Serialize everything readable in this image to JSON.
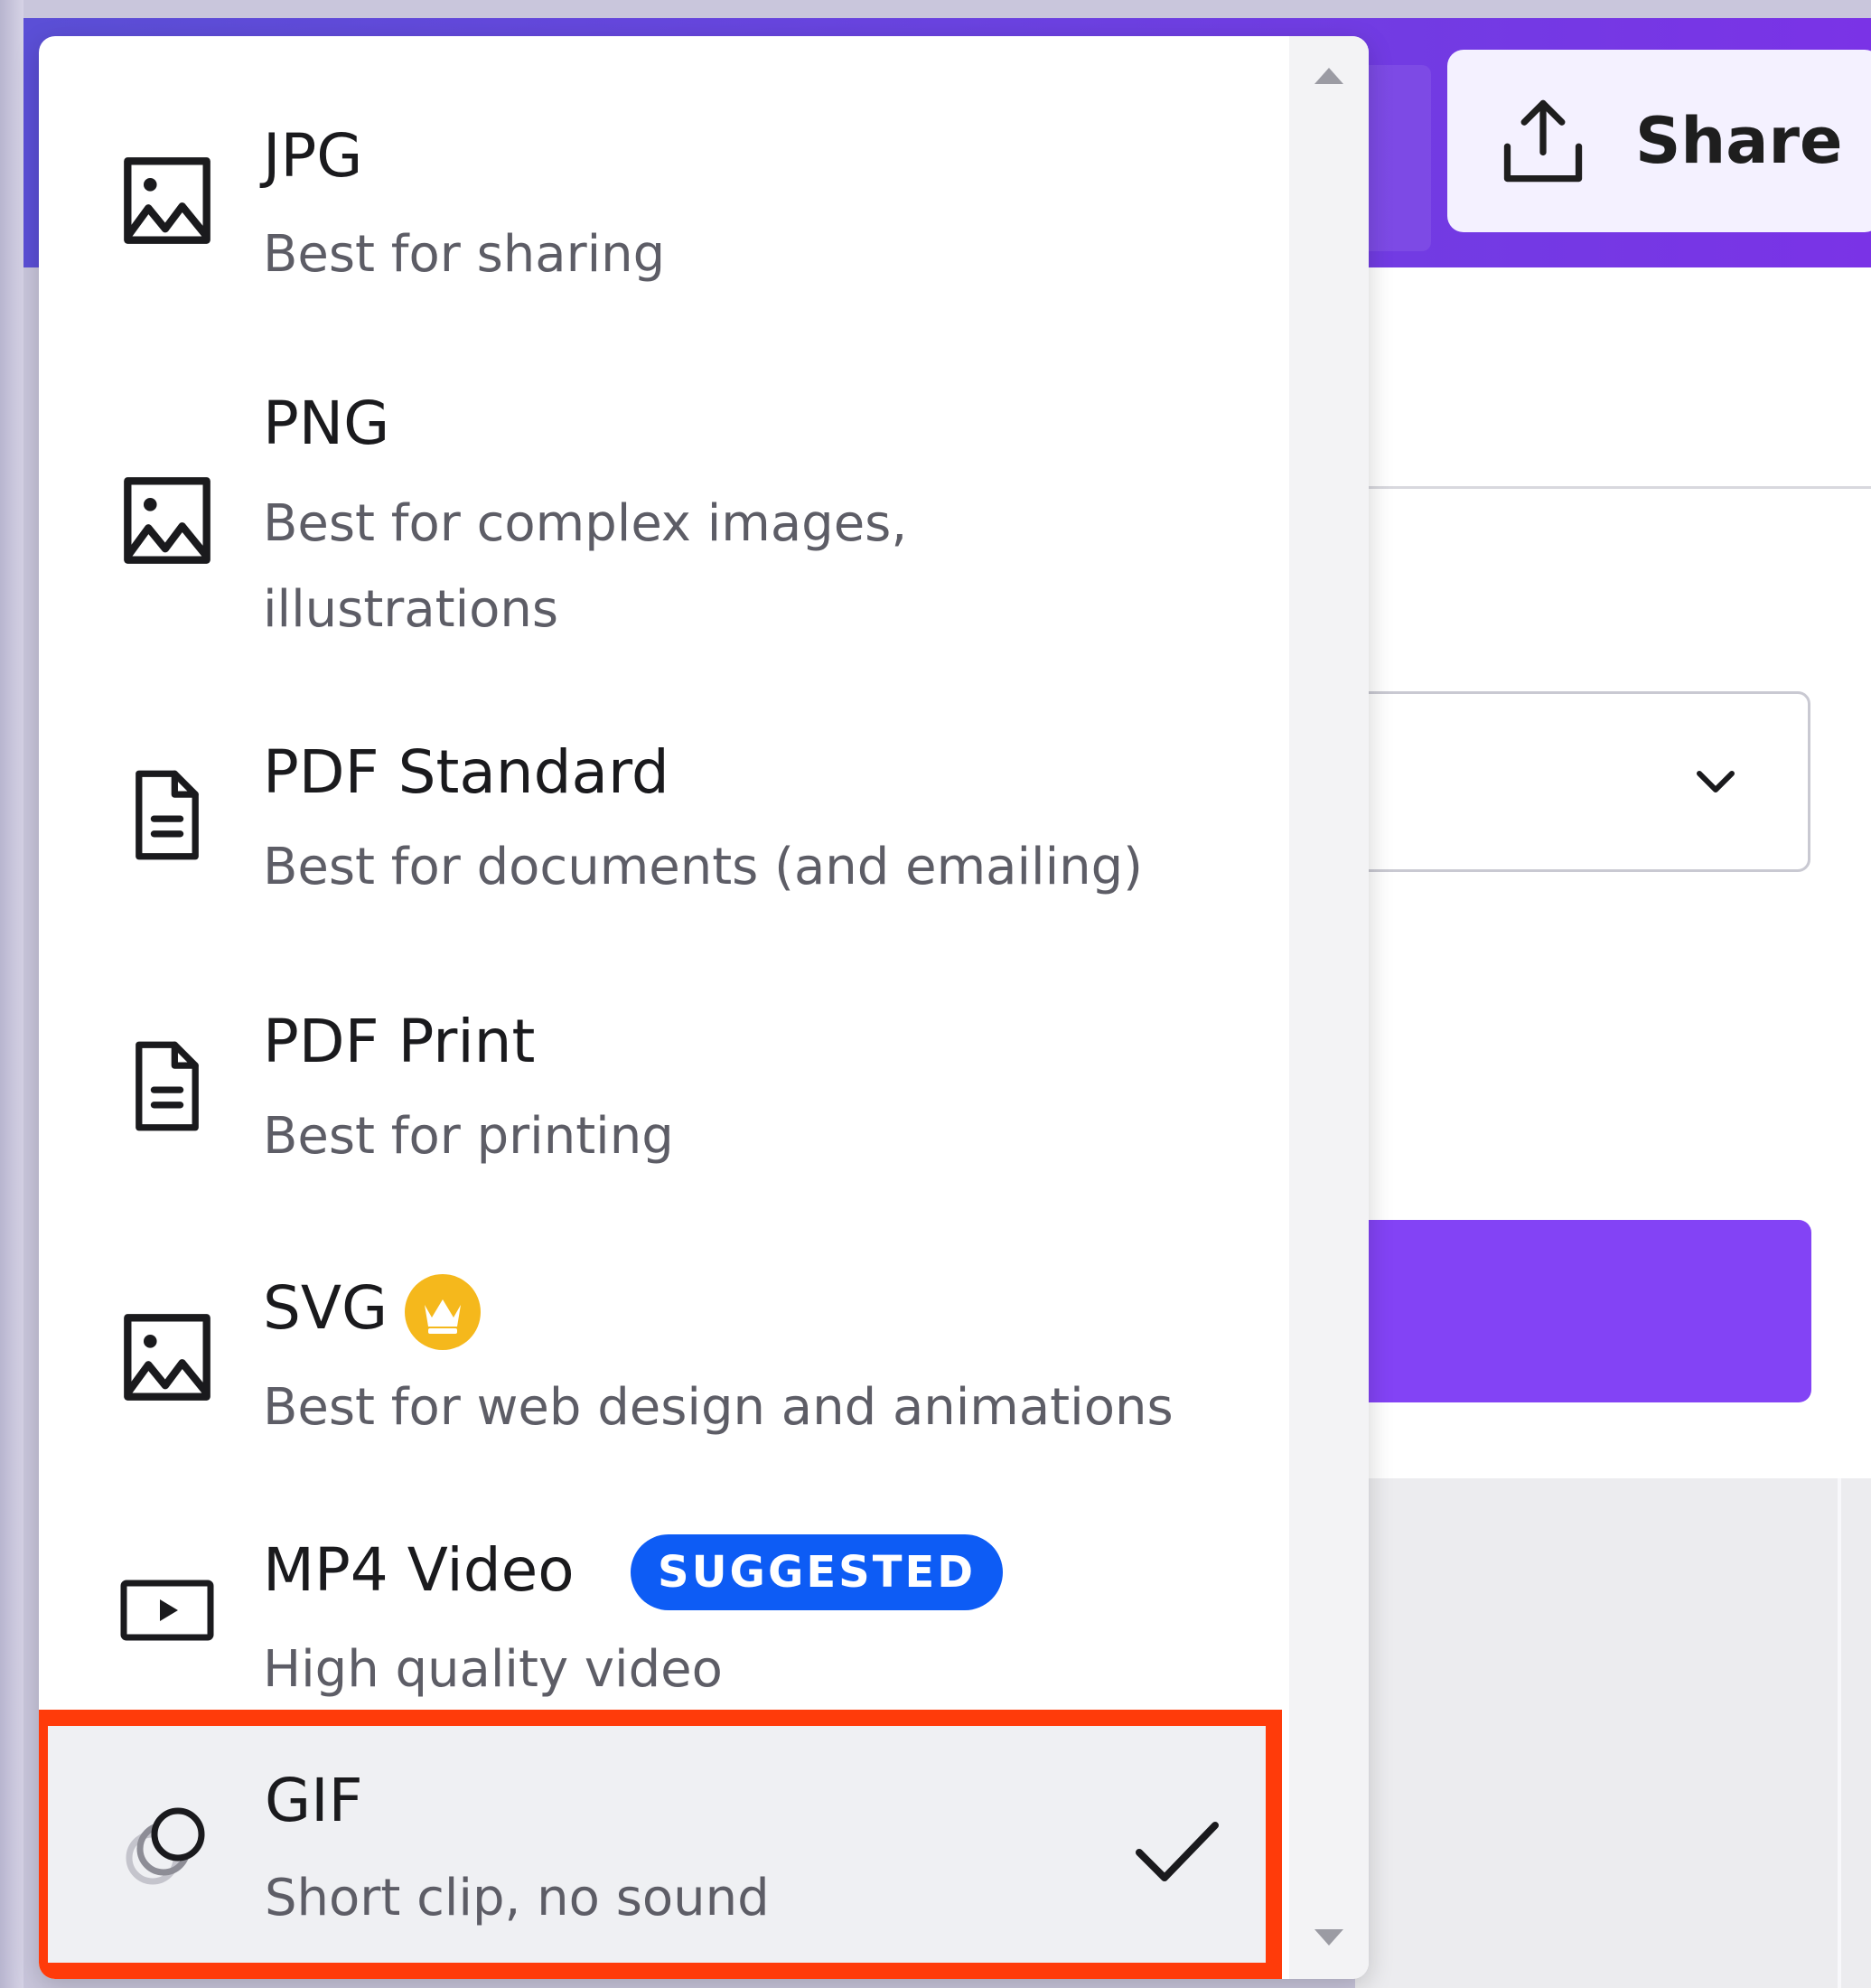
{
  "topbar": {
    "share_label": "Share"
  },
  "menu": {
    "options": [
      {
        "title": "JPG",
        "desc": "Best for sharing",
        "icon": "image-icon"
      },
      {
        "title": "PNG",
        "desc": "Best for complex images, illustrations",
        "desc_line1": "Best for complex images,",
        "desc_line2": "illustrations",
        "icon": "image-icon"
      },
      {
        "title": "PDF Standard",
        "desc": "Best for documents (and emailing)",
        "icon": "document-icon"
      },
      {
        "title": "PDF Print",
        "desc": "Best for printing",
        "icon": "document-icon"
      },
      {
        "title": "SVG",
        "desc": "Best for web design and animations",
        "icon": "image-icon",
        "badge_icon": "crown-icon"
      },
      {
        "title": "MP4 Video",
        "desc": "High quality video",
        "icon": "video-icon",
        "badge": "SUGGESTED"
      },
      {
        "title": "GIF",
        "desc": "Short clip, no sound",
        "icon": "gif-icon",
        "selected": true,
        "check_icon": "checkmark-icon"
      }
    ]
  },
  "colors": {
    "brand_gradient_start": "#5b4fd6",
    "brand_gradient_end": "#7a33e6",
    "primary_button": "#8343f5",
    "badge_blue": "#0d5cf5",
    "crown_yellow": "#f5b81c",
    "highlight_red": "#ff3b0a"
  }
}
